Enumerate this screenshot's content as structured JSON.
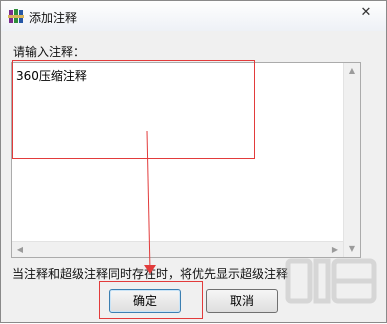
{
  "window": {
    "title": "添加注释",
    "close_glyph": "✕"
  },
  "form": {
    "prompt_label": "请输入注释：",
    "comment_value": "360压缩注释",
    "notice": "当注释和超级注释同时存在时，将优先显示超级注释"
  },
  "buttons": {
    "ok_label": "确定",
    "cancel_label": "取消"
  },
  "icons": {
    "app": "winrar-books-icon",
    "close": "close-icon",
    "scroll_up": "scroll-up-arrow-icon",
    "scroll_down": "scroll-down-arrow-icon",
    "scroll_left": "scroll-left-arrow-icon",
    "scroll_right": "scroll-right-arrow-icon"
  },
  "colors": {
    "annotation": "#e23b3b",
    "accent": "#3c7fb1"
  }
}
